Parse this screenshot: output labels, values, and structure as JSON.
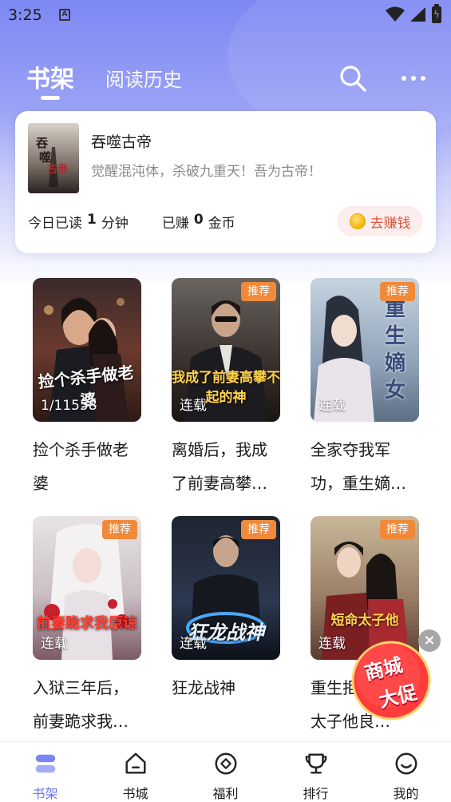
{
  "status_bar": {
    "time": "3:25",
    "notification_icon": "A"
  },
  "header": {
    "tabs": [
      {
        "label": "书架",
        "active": true
      },
      {
        "label": "阅读历史",
        "active": false
      }
    ],
    "icons": [
      "search-icon",
      "more-icon"
    ]
  },
  "reading_card": {
    "title": "吞噬古帝",
    "description": "觉醒混沌体，杀破九重天！吾为古帝！",
    "stats": {
      "read_prefix": "今日已读",
      "read_value": "1",
      "read_unit": "分钟",
      "earn_prefix": "已赚",
      "earn_value": "0",
      "earn_unit": "金币"
    },
    "earn_button": "去赚钱"
  },
  "books": [
    {
      "title": "捡个杀手做老婆",
      "status": "1/11558",
      "badge": "",
      "cover_text": "捡个杀手做老婆"
    },
    {
      "title": "离婚后，我成了前妻高攀…",
      "status": "连载",
      "badge": "推荐",
      "cover_text": "我成了前妻高攀不起的神"
    },
    {
      "title": "全家夺我军功，重生嫡…",
      "status": "连载",
      "badge": "推荐",
      "cover_text": "重生嫡女"
    },
    {
      "title": "入狱三年后，前妻跪求我…",
      "status": "连载",
      "badge": "推荐",
      "cover_text": "前妻跪求我原谅"
    },
    {
      "title": "狂龙战神",
      "status": "连载",
      "badge": "推荐",
      "cover_text": "狂龙战神"
    },
    {
      "title": "重生拒嫁短命太子他良…",
      "status": "连载",
      "badge": "推荐",
      "cover_text": "短命太子他"
    }
  ],
  "promo": {
    "line1": "商城",
    "line2": "大促",
    "close": "×"
  },
  "bottom_nav": [
    {
      "label": "书架",
      "icon": "bookshelf-icon",
      "active": true
    },
    {
      "label": "书城",
      "icon": "bookstore-icon",
      "active": false
    },
    {
      "label": "福利",
      "icon": "welfare-icon",
      "active": false
    },
    {
      "label": "排行",
      "icon": "trophy-icon",
      "active": false
    },
    {
      "label": "我的",
      "icon": "profile-icon",
      "active": false
    }
  ],
  "colors": {
    "header_gradient_top": "#7e88f4",
    "accent": "#6a74f0",
    "badge": "#f08a3a",
    "earn_text": "#e0553d",
    "earn_bg": "#fdeeee"
  }
}
